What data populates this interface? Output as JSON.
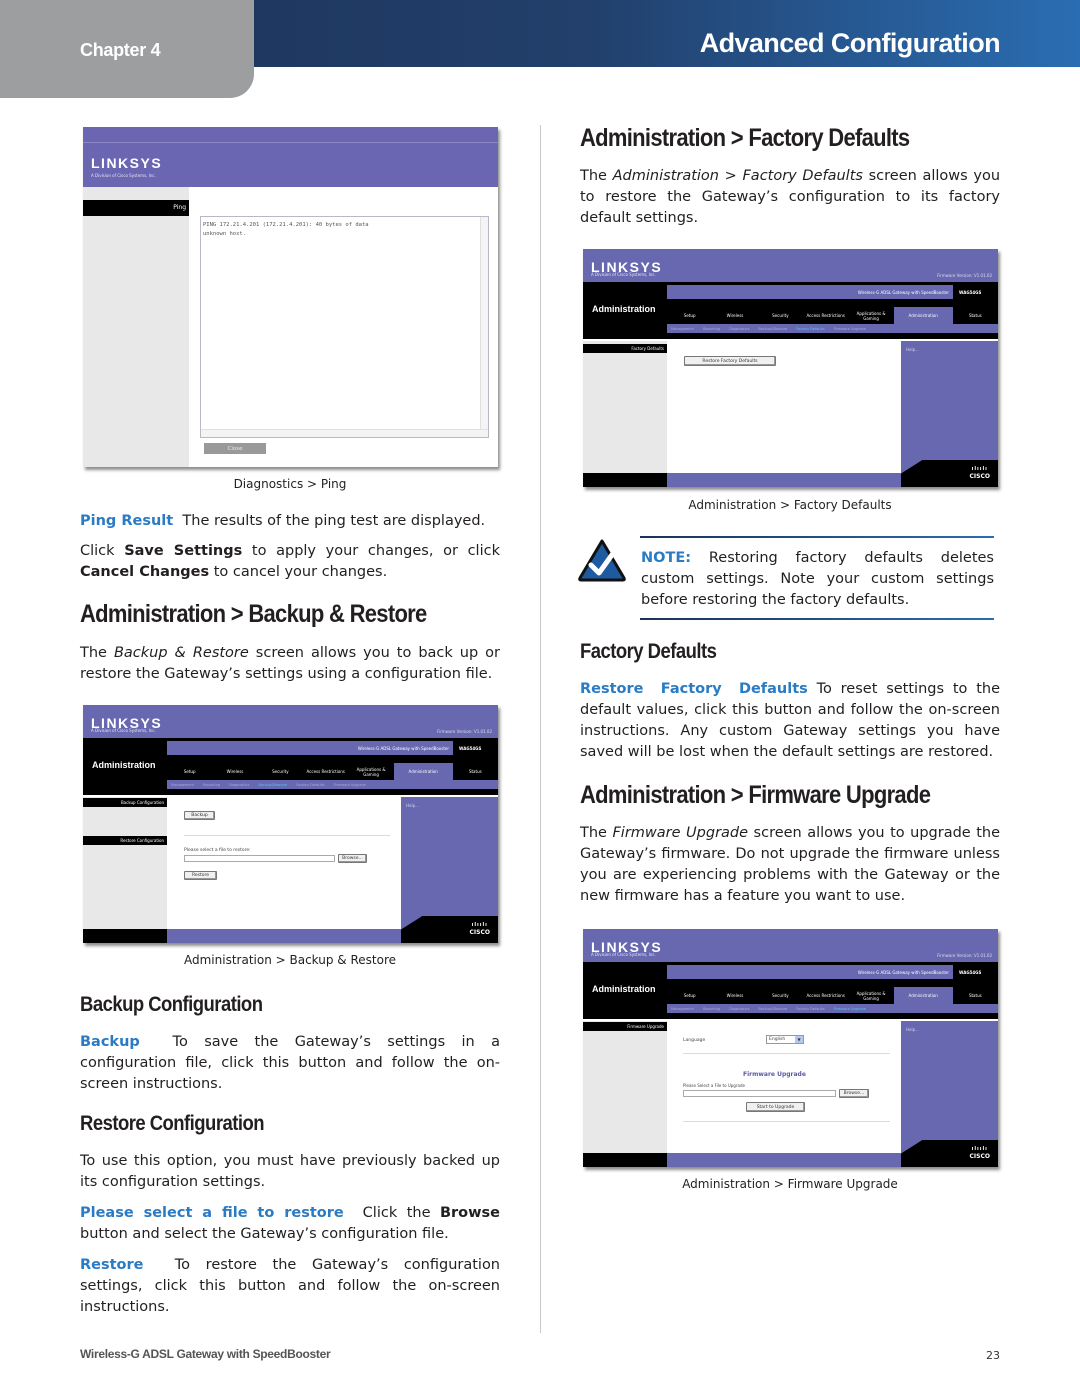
{
  "header": {
    "chapter_label": "Chapter 4",
    "section_title": "Advanced Configuration"
  },
  "left": {
    "ping_screenshot": {
      "logo": "LINKSYS",
      "logo_sub": "A Division of Cisco Systems, Inc.",
      "side_label": "Ping",
      "output_line1": "PING 172.21.4.201 (172.21.4.201): 40 bytes of data",
      "output_line2": "unknown host.",
      "close_button": "Close",
      "caption": "Diagnostics > Ping"
    },
    "ping_result": {
      "term": "Ping Result",
      "text": "The results of the ping test are displayed."
    },
    "save_note": {
      "pre": "Click ",
      "save": "Save Settings",
      "mid": " to apply your changes, or click ",
      "cancel": "Cancel Changes",
      "post": " to cancel your changes."
    },
    "backup_restore_heading": "Administration > Backup & Restore",
    "backup_restore_intro": {
      "pre": "The ",
      "italic": "Backup & Restore",
      "post": " screen allows you to back up or restore the Gateway’s settings using a configuration file."
    },
    "backup_screenshot": {
      "logo": "LINKSYS",
      "logo_sub": "A Division of Cisco Systems, Inc.",
      "firmware_version": "Firmware Version: V1.01.02",
      "product": "Wireless-G ADSL Gateway with SpeedBooster",
      "model": "WAG54GS",
      "page_title": "Administration",
      "tabs": [
        "Setup",
        "Wireless",
        "Security",
        "Access Restrictions",
        "Applications & Gaming",
        "Administration",
        "Status"
      ],
      "active_tab": "Administration",
      "subtabs": [
        "Management",
        "Reporting",
        "Diagnostics",
        "Backup&Restore",
        "Factory Defaults",
        "Firmware Upgrade"
      ],
      "active_subtab": "Backup&Restore",
      "side_labels": [
        "Backup Configuration",
        "Restore Configuration"
      ],
      "backup_button": "Backup",
      "restore_prompt": "Please select a file to restore:",
      "browse_button": "Browse...",
      "restore_button": "Restore",
      "help_label": "Help...",
      "cisco": "CISCO",
      "caption": "Administration > Backup & Restore"
    },
    "backup_config_heading": "Backup Configuration",
    "backup_desc": {
      "term": "Backup",
      "text": "To save the Gateway’s settings in a configuration file, click this button and follow the on-screen instructions."
    },
    "restore_config_heading": "Restore Configuration",
    "restore_intro": "To use this option, you must have previously backed up its configuration settings.",
    "select_file_desc": {
      "term": "Please select a file to restore",
      "pre": "Click the ",
      "bold": "Browse",
      "post": " button and select the Gateway’s configuration file."
    },
    "restore_desc": {
      "term": "Restore",
      "text": "To restore the Gateway’s configuration settings, click this button and follow the on-screen instructions."
    }
  },
  "right": {
    "factory_heading": "Administration > Factory Defaults",
    "factory_intro": {
      "pre": "The ",
      "italic": "Administration > Factory Defaults",
      "post": " screen allows you to restore the Gateway’s configuration to its factory default settings."
    },
    "factory_screenshot": {
      "logo": "LINKSYS",
      "logo_sub": "A Division of Cisco Systems, Inc.",
      "firmware_version": "Firmware Version: V1.01.02",
      "product": "Wireless-G ADSL Gateway with SpeedBooster",
      "model": "WAG54GS",
      "page_title": "Administration",
      "tabs": [
        "Setup",
        "Wireless",
        "Security",
        "Access Restrictions",
        "Applications & Gaming",
        "Administration",
        "Status"
      ],
      "active_tab": "Administration",
      "subtabs": [
        "Management",
        "Reporting",
        "Diagnostics",
        "Backup&Restore",
        "Factory Defaults",
        "Firmware Upgrade"
      ],
      "active_subtab": "Factory Defaults",
      "side_label": "Factory Defaults",
      "restore_button": "Restore Factory Defaults",
      "help_label": "Help...",
      "cisco": "CISCO",
      "caption": "Administration > Factory Defaults"
    },
    "note": {
      "label": "NOTE:",
      "text": " Restoring factory defaults deletes custom settings. Note your custom settings before restoring the factory defaults."
    },
    "factory_defaults_heading": "Factory Defaults",
    "restore_factory_desc": {
      "term": "Restore Factory Defaults",
      "text": " To reset settings to the default values, click this button and follow the on-screen instructions. Any custom Gateway settings you have saved will be lost when the default settings are restored."
    },
    "firmware_heading": "Administration > Firmware Upgrade",
    "firmware_intro": {
      "pre": "The ",
      "italic": "Firmware Upgrade",
      "post": " screen allows you to upgrade the Gateway’s firmware. Do not upgrade the firmware unless you are experiencing problems with the Gateway or the new firmware has a feature you want to use."
    },
    "firmware_screenshot": {
      "logo": "LINKSYS",
      "logo_sub": "A Division of Cisco Systems, Inc.",
      "firmware_version": "Firmware Version: V1.01.02",
      "product": "Wireless-G ADSL Gateway with SpeedBooster",
      "model": "WAG54GS",
      "page_title": "Administration",
      "tabs": [
        "Setup",
        "Wireless",
        "Security",
        "Access Restrictions",
        "Applications & Gaming",
        "Administration",
        "Status"
      ],
      "active_tab": "Administration",
      "subtabs": [
        "Management",
        "Reporting",
        "Diagnostics",
        "Backup&Restore",
        "Factory Defaults",
        "Firmware Upgrade"
      ],
      "active_subtab": "Firmware Upgrade",
      "side_label": "Firmware Upgrade",
      "language_label": "Language",
      "language_value": "English",
      "upgrade_title": "Firmware Upgrade",
      "file_prompt": "Please Select a File to Upgrade",
      "browse_button": "Browse...",
      "start_button": "Start to Upgrade",
      "help_label": "Help...",
      "cisco": "CISCO",
      "caption": "Administration > Firmware Upgrade"
    }
  },
  "footer": {
    "product_name": "Wireless-G ADSL Gateway with SpeedBooster",
    "page_number": "23"
  }
}
